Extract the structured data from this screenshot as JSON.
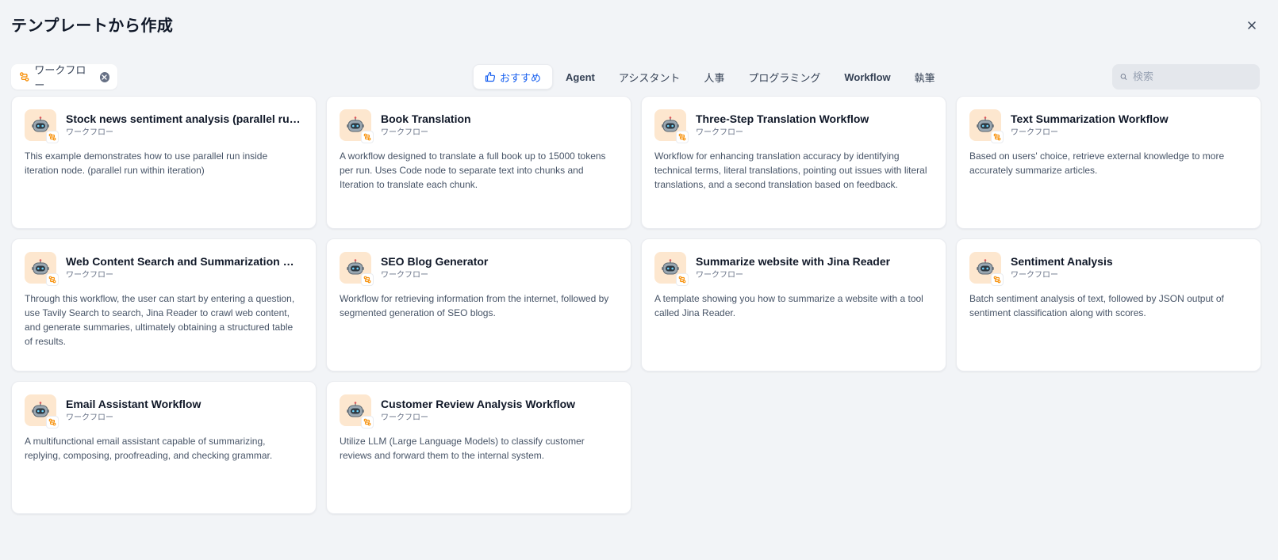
{
  "header": {
    "title": "テンプレートから作成",
    "close_icon": "close-icon"
  },
  "filter": {
    "icon": "workflow-icon",
    "label": "ワークフロー",
    "clear_icon": "clear-icon"
  },
  "tabs": [
    {
      "label": "おすすめ",
      "active": true,
      "icon": "thumbs-up-icon"
    },
    {
      "label": "Agent",
      "active": false
    },
    {
      "label": "アシスタント",
      "active": false
    },
    {
      "label": "人事",
      "active": false
    },
    {
      "label": "プログラミング",
      "active": false
    },
    {
      "label": "Workflow",
      "active": false
    },
    {
      "label": "執筆",
      "active": false
    }
  ],
  "search": {
    "placeholder": "検索",
    "icon": "search-icon"
  },
  "colors": {
    "accent": "#155eef",
    "icon_bg": "#fde7cf",
    "workflow_orange": "#f79009"
  },
  "cards": [
    {
      "title": "Stock news sentiment analysis (parallel run within iteration)",
      "type": "ワークフロー",
      "description": "This example demonstrates how to use parallel run inside iteration node. (parallel run within iteration)"
    },
    {
      "title": "Book Translation",
      "type": "ワークフロー",
      "description": "A workflow designed to translate a full book up to 15000 tokens per run. Uses Code node to separate text into chunks and Iteration to translate each chunk."
    },
    {
      "title": "Three-Step Translation Workflow",
      "type": "ワークフロー",
      "description": "Workflow for enhancing translation accuracy by identifying technical terms, literal translations, pointing out issues with literal translations, and a second translation based on feedback."
    },
    {
      "title": "Text Summarization Workflow",
      "type": "ワークフロー",
      "description": "Based on users' choice, retrieve external knowledge to more accurately summarize articles."
    },
    {
      "title": "Web Content Search and Summarization Workflow",
      "type": "ワークフロー",
      "description": "Through this workflow, the user can start by entering a question, use Tavily Search to search, Jina Reader to crawl web content, and generate summaries, ultimately obtaining a structured table of results."
    },
    {
      "title": "SEO Blog Generator",
      "type": "ワークフロー",
      "description": "Workflow for retrieving information from the internet, followed by segmented generation of SEO blogs."
    },
    {
      "title": "Summarize website with Jina Reader",
      "type": "ワークフロー",
      "description": "A template showing you how to summarize a website with a tool called Jina Reader."
    },
    {
      "title": "Sentiment Analysis",
      "type": "ワークフロー",
      "description": "Batch sentiment analysis of text, followed by JSON output of sentiment classification along with scores."
    },
    {
      "title": "Email Assistant Workflow",
      "type": "ワークフロー",
      "description": "A multifunctional email assistant capable of summarizing, replying, composing, proofreading, and checking grammar."
    },
    {
      "title": "Customer Review Analysis Workflow",
      "type": "ワークフロー",
      "description": "Utilize LLM (Large Language Models) to classify customer reviews and forward them to the internal system."
    }
  ]
}
